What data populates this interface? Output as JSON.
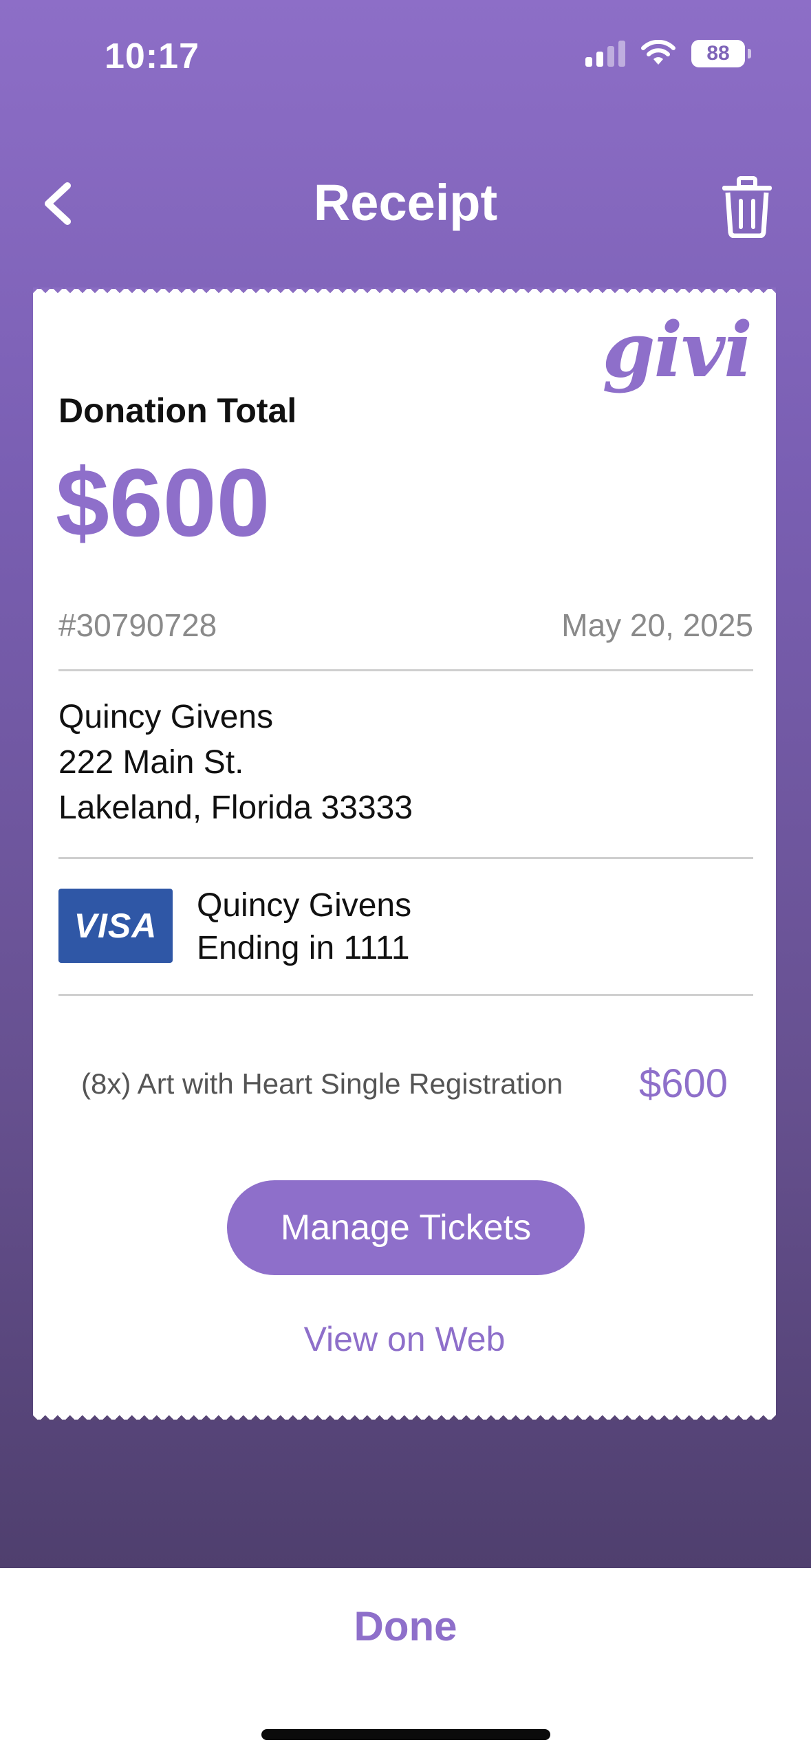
{
  "status_bar": {
    "time": "10:17",
    "battery": "88"
  },
  "nav": {
    "title": "Receipt",
    "back_icon": "chevron-left-icon",
    "delete_icon": "trash-icon"
  },
  "receipt": {
    "logo": "givi",
    "donation_label": "Donation Total",
    "donation_amount": "$600",
    "receipt_number": "#30790728",
    "date": "May 20, 2025",
    "donor": {
      "name": "Quincy Givens",
      "street": "222 Main St.",
      "city_line": "Lakeland, Florida 33333"
    },
    "payment": {
      "card_brand": "VISA",
      "cardholder": "Quincy Givens",
      "ending": "Ending in 1111"
    },
    "line_items": [
      {
        "description": "(8x) Art with Heart Single Registration",
        "amount": "$600"
      }
    ],
    "manage_button": "Manage Tickets",
    "web_link": "View on Web"
  },
  "footer": {
    "done_label": "Done"
  },
  "colors": {
    "accent": "#8e6fca",
    "visa_blue": "#2f57a6",
    "visa_gold": "#f5a623"
  }
}
